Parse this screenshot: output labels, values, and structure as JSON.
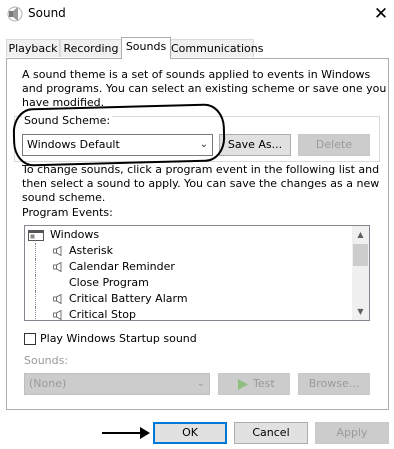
{
  "window": {
    "title": "Sound",
    "icon": "speaker-icon",
    "close_glyph": "✕"
  },
  "tabs": [
    {
      "label": "Playback"
    },
    {
      "label": "Recording"
    },
    {
      "label": "Sounds",
      "active": true
    },
    {
      "label": "Communications"
    }
  ],
  "sounds_tab": {
    "intro_lines": [
      "A sound theme is a set of sounds applied to events in Windows",
      "and programs.  You can select an existing scheme or save one you",
      "have modified."
    ],
    "scheme_label": "Sound Scheme:",
    "scheme_value": "Windows Default",
    "save_as_label": "Save As...",
    "delete_label": "Delete",
    "change_lines": [
      "To change sounds, click a program event in the following list and",
      "then select a sound to apply.  You can save the changes as a new",
      "sound scheme."
    ],
    "program_events_label": "Program Events:",
    "events": [
      {
        "label": "Windows",
        "kind": "group"
      },
      {
        "label": "Asterisk",
        "kind": "event",
        "has_sound": true
      },
      {
        "label": "Calendar Reminder",
        "kind": "event",
        "has_sound": true
      },
      {
        "label": "Close Program",
        "kind": "event",
        "has_sound": false
      },
      {
        "label": "Critical Battery Alarm",
        "kind": "event",
        "has_sound": true
      },
      {
        "label": "Critical Stop",
        "kind": "event",
        "has_sound": true
      }
    ],
    "startup_checkbox_label": "Play Windows Startup sound",
    "startup_checked": false,
    "sounds_label": "Sounds:",
    "sounds_value": "(None)",
    "test_label": "Test",
    "browse_label": "Browse..."
  },
  "footer": {
    "ok_label": "OK",
    "cancel_label": "Cancel",
    "apply_label": "Apply"
  },
  "colors": {
    "focus_blue": "#0078d7",
    "disabled_text": "#9a9a9a",
    "button_face": "#e1e1e1"
  }
}
